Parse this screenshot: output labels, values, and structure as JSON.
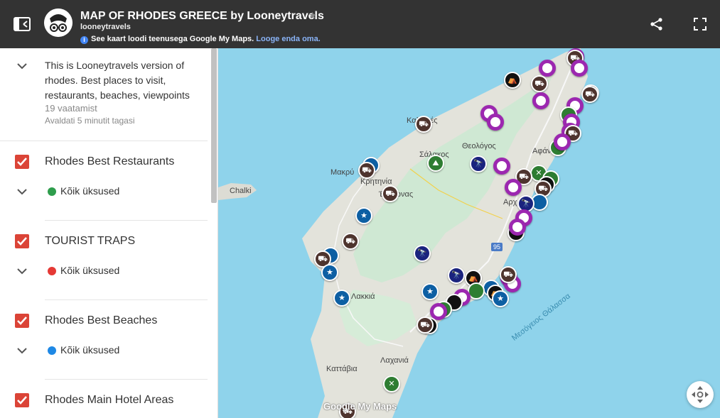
{
  "header": {
    "title": "MAP OF RHODES GREECE by Looneytravels",
    "owner": "looneytravels",
    "info_text": "See kaart loodi teenusega Google My Maps.",
    "info_link": "Looge enda oma."
  },
  "description": {
    "text": "This is Looneytravels version of rhodes. Best places to visit, restaurants, beaches, viewpoints",
    "views": "19 vaatamist",
    "published": "Avaldati 5 minutit tagasi"
  },
  "layers": [
    {
      "title": "Rhodes Best Restaurants",
      "sub": "Kõik üksused",
      "icon_color": "#2e9d4c"
    },
    {
      "title": "TOURIST TRAPS",
      "sub": "Kõik üksused",
      "icon_color": "#e53935"
    },
    {
      "title": "Rhodes Best Beaches",
      "sub": "Kõik üksused",
      "icon_color": "#1e88e5"
    },
    {
      "title": "Rhodes Main Hotel Areas",
      "sub": "",
      "icon_color": ""
    }
  ],
  "map": {
    "labels": {
      "chalki": "Chalki",
      "theologos": "Θεολόγος",
      "kalythies": "Καλυθιές",
      "salakos": "Σάλακος",
      "makry": "Μακρύ",
      "kritinia": "Κρητηνία",
      "emponas": "Έμπωνας",
      "afantou": "Αφάν",
      "archangelos": "Αρχ",
      "lakkia": "Λακκιά",
      "kattavia": "Καττάβια",
      "lachania": "Λαχανιά",
      "mesogeios": "Μεσόγειος Θάλασσα",
      "road": "95",
      "gm": "Google My Maps"
    }
  }
}
